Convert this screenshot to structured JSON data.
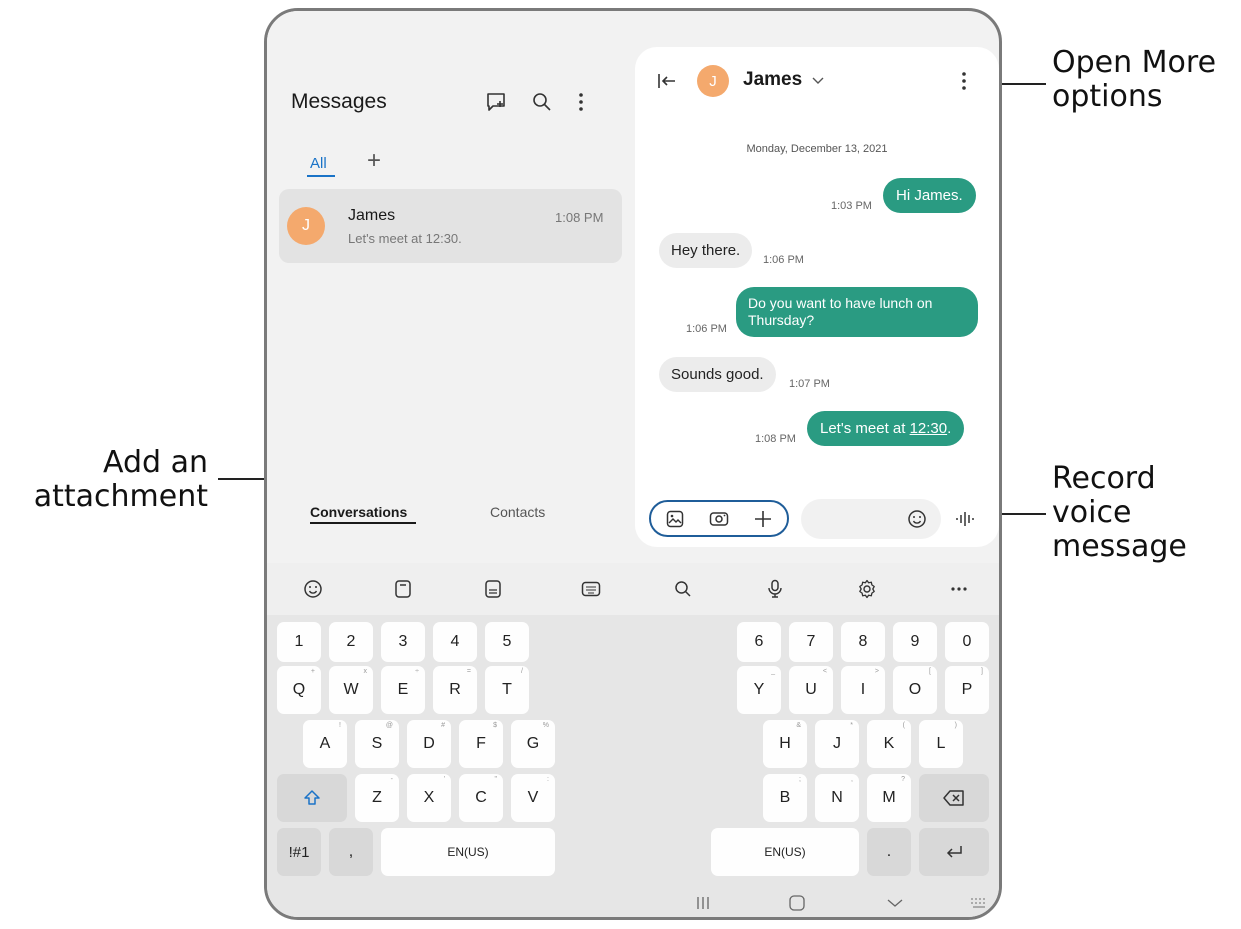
{
  "messages_title": "Messages",
  "tabs": {
    "all": "All",
    "add": "+"
  },
  "conversation": {
    "name": "James",
    "preview": "Let's meet at 12:30.",
    "time": "1:08 PM",
    "initial": "J"
  },
  "bottom_tabs": {
    "conversations": "Conversations",
    "contacts": "Contacts"
  },
  "chat": {
    "contact": "James",
    "initial": "J",
    "date": "Monday, December 13, 2021",
    "messages": [
      {
        "dir": "out",
        "text": "Hi James.",
        "time": "1:03 PM"
      },
      {
        "dir": "in",
        "text": "Hey there.",
        "time": "1:06 PM"
      },
      {
        "dir": "out",
        "text": "Do you want to have lunch on Thursday?",
        "time": "1:06 PM"
      },
      {
        "dir": "in",
        "text": "Sounds good.",
        "time": "1:07 PM"
      },
      {
        "dir": "out",
        "text_pre": "Let's meet at ",
        "text_link": "12:30",
        "text_post": ".",
        "time": "1:08 PM"
      }
    ]
  },
  "keyboard": {
    "left_numbers": [
      "1",
      "2",
      "3",
      "4",
      "5"
    ],
    "right_numbers": [
      "6",
      "7",
      "8",
      "9",
      "0"
    ],
    "left_row1": [
      "Q",
      "W",
      "E",
      "R",
      "T"
    ],
    "left_row1_sup": [
      "+",
      "x",
      "÷",
      "=",
      "/"
    ],
    "right_row1": [
      "Y",
      "U",
      "I",
      "O",
      "P"
    ],
    "right_row1_sup": [
      "_",
      "<",
      ">",
      "[",
      "]"
    ],
    "left_row2": [
      "A",
      "S",
      "D",
      "F",
      "G"
    ],
    "left_row2_sup": [
      "!",
      "@",
      "#",
      "$",
      "%"
    ],
    "right_row2": [
      "H",
      "J",
      "K",
      "L"
    ],
    "right_row2_sup": [
      "&",
      "*",
      "(",
      ")"
    ],
    "left_row3": [
      "Z",
      "X",
      "C",
      "V"
    ],
    "left_row3_sup": [
      "-",
      "'",
      "\"",
      ":"
    ],
    "right_row3": [
      "B",
      "N",
      "M"
    ],
    "right_row3_sup": [
      ";",
      ",",
      "?"
    ],
    "symbols": "!#1",
    "comma": ",",
    "period": ".",
    "space_left": "EN(US)",
    "space_right": "EN(US)"
  },
  "callouts": {
    "more_options_1": "Open More",
    "more_options_2": "options",
    "attachment_1": "Add an",
    "attachment_2": "attachment",
    "voice_1": "Record",
    "voice_2": "voice",
    "voice_3": "message"
  },
  "colors": {
    "accent": "#2a9b82",
    "avatar": "#f4a96d",
    "tab_underline": "#1a73c7"
  }
}
